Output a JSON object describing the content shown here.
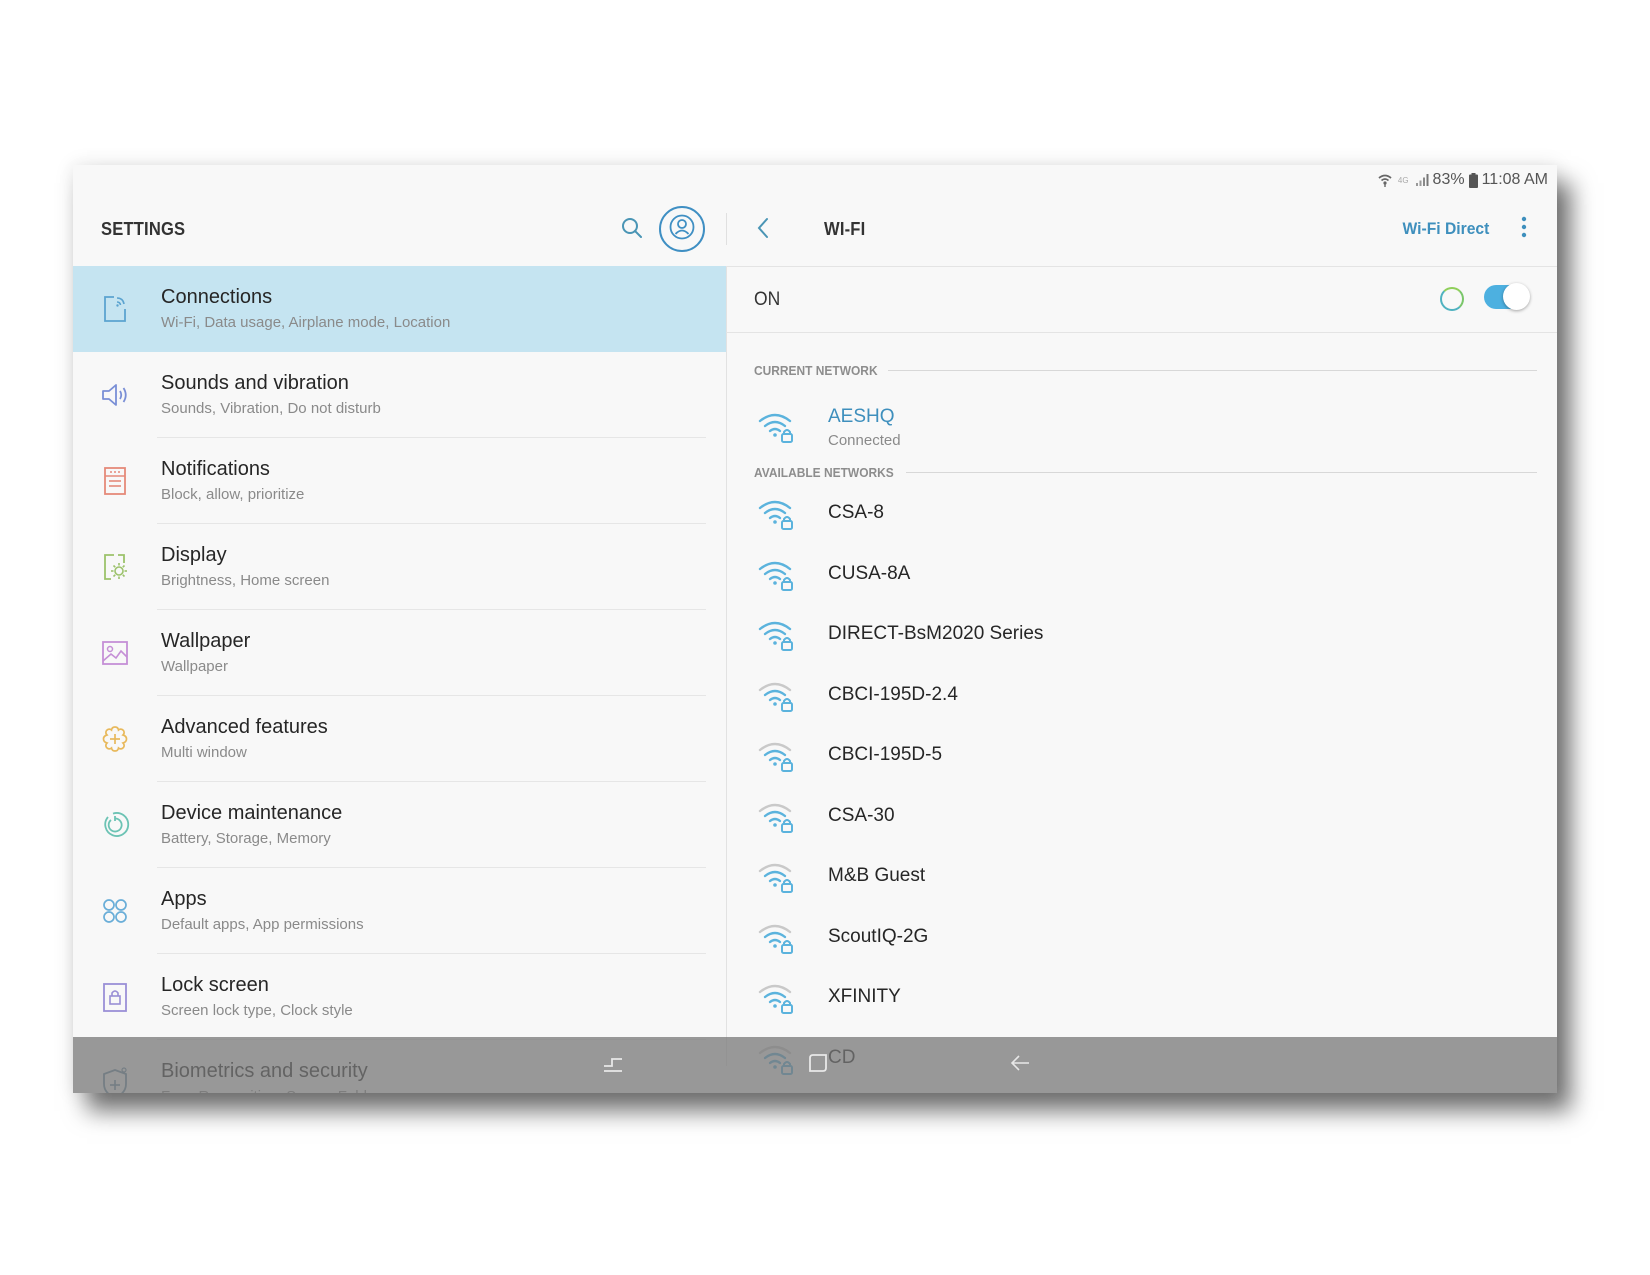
{
  "status_bar": {
    "wifi_icon": "wifi-icon",
    "network_type": "4G",
    "signal_icon": "cell-signal-icon",
    "battery_percent": "83%",
    "battery_icon": "battery-icon",
    "time": "11:08 AM"
  },
  "settings": {
    "title": "SETTINGS",
    "search_icon": "search-icon",
    "profile_icon": "profile-icon",
    "items": [
      {
        "title": "Connections",
        "subtitle": "Wi-Fi, Data usage, Airplane mode, Location",
        "icon": "connections-icon",
        "color": "#5ba3d0",
        "active": true
      },
      {
        "title": "Sounds and vibration",
        "subtitle": "Sounds, Vibration, Do not disturb",
        "icon": "speaker-icon",
        "color": "#7a8fd6",
        "active": false
      },
      {
        "title": "Notifications",
        "subtitle": "Block, allow, prioritize",
        "icon": "notifications-icon",
        "color": "#e58a7a",
        "active": false
      },
      {
        "title": "Display",
        "subtitle": "Brightness, Home screen",
        "icon": "display-icon",
        "color": "#9cc26b",
        "active": false
      },
      {
        "title": "Wallpaper",
        "subtitle": "Wallpaper",
        "icon": "wallpaper-icon",
        "color": "#c58fd6",
        "active": false
      },
      {
        "title": "Advanced features",
        "subtitle": "Multi window",
        "icon": "advanced-features-icon",
        "color": "#e8b95c",
        "active": false
      },
      {
        "title": "Device maintenance",
        "subtitle": "Battery, Storage, Memory",
        "icon": "device-maintenance-icon",
        "color": "#6cc3b4",
        "active": false
      },
      {
        "title": "Apps",
        "subtitle": "Default apps, App permissions",
        "icon": "apps-icon",
        "color": "#6aaed8",
        "active": false
      },
      {
        "title": "Lock screen",
        "subtitle": "Screen lock type, Clock style",
        "icon": "lock-screen-icon",
        "color": "#9a8fd6",
        "active": false
      },
      {
        "title": "Biometrics and security",
        "subtitle": "Face Recognition, Secure Folder",
        "icon": "biometrics-icon",
        "color": "#6b8fa8",
        "active": false
      }
    ]
  },
  "wifi": {
    "title": "WI-FI",
    "back_icon": "chevron-left-icon",
    "wifi_direct_label": "Wi-Fi Direct",
    "more_icon": "more-vert-icon",
    "state_label": "ON",
    "enabled": true,
    "current_section": "CURRENT NETWORK",
    "current_network": {
      "name": "AESHQ",
      "status": "Connected",
      "signal_level": 3,
      "secured": true
    },
    "available_section": "AVAILABLE NETWORKS",
    "networks": [
      {
        "name": "CSA-8",
        "signal_level": 3,
        "secured": true
      },
      {
        "name": "CUSA-8A",
        "signal_level": 3,
        "secured": true
      },
      {
        "name": "DIRECT-BsM2020 Series",
        "signal_level": 3,
        "secured": true
      },
      {
        "name": "CBCI-195D-2.4",
        "signal_level": 2,
        "secured": true
      },
      {
        "name": "CBCI-195D-5",
        "signal_level": 2,
        "secured": true
      },
      {
        "name": "CSA-30",
        "signal_level": 2,
        "secured": true
      },
      {
        "name": "M&B Guest",
        "signal_level": 2,
        "secured": true
      },
      {
        "name": "ScoutIQ-2G",
        "signal_level": 2,
        "secured": true
      },
      {
        "name": "XFINITY",
        "signal_level": 2,
        "secured": true
      },
      {
        "name": "CD",
        "signal_level": 2,
        "secured": true
      }
    ]
  },
  "nav_bar": {
    "recents_icon": "recents-icon",
    "home_icon": "home-icon",
    "back_icon": "back-arrow-icon"
  },
  "colors": {
    "accent": "#3e8fbd",
    "selected_row": "#c5e4f1",
    "toggle_on": "#4db0e0"
  }
}
